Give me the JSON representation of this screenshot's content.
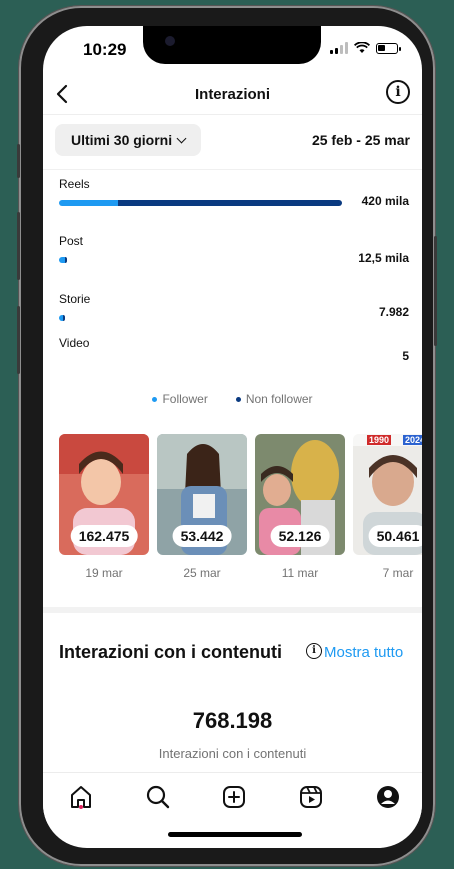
{
  "status_bar": {
    "time": "10:29"
  },
  "header": {
    "title": "Interazioni"
  },
  "filter": {
    "range_label": "Ultimi 30 giorni",
    "dates": "25 feb - 25 mar"
  },
  "breakdown": [
    {
      "label": "Reels",
      "value": "420 mila",
      "follower_share": 0.21,
      "total_fraction": 1.0
    },
    {
      "label": "Post",
      "value": "12,5 mila",
      "follower_share": 0.7,
      "total_fraction": 0.03
    },
    {
      "label": "Storie",
      "value": "7.982",
      "follower_share": 0.6,
      "total_fraction": 0.02
    },
    {
      "label": "Video",
      "value": "5",
      "follower_share": 0.0,
      "total_fraction": 0.0
    }
  ],
  "legend": {
    "follower": "Follower",
    "non_follower": "Non follower"
  },
  "colors": {
    "follower": "#1e9af2",
    "non_follower": "#0a3a80",
    "link": "#1e9af2"
  },
  "top_content": [
    {
      "count": "162.475",
      "date": "19 mar"
    },
    {
      "count": "53.442",
      "date": "25 mar"
    },
    {
      "count": "52.126",
      "date": "11 mar"
    },
    {
      "count": "50.461",
      "date": "7 mar",
      "overlay_left": "1990",
      "overlay_right": "2024"
    }
  ],
  "content_interactions": {
    "title": "Interazioni con i contenuti",
    "link": "Mostra tutto",
    "total": "768.198",
    "caption": "Interazioni con i contenuti"
  },
  "tabbar": [
    "home-icon",
    "search-icon",
    "create-icon",
    "reels-icon",
    "profile-icon"
  ]
}
